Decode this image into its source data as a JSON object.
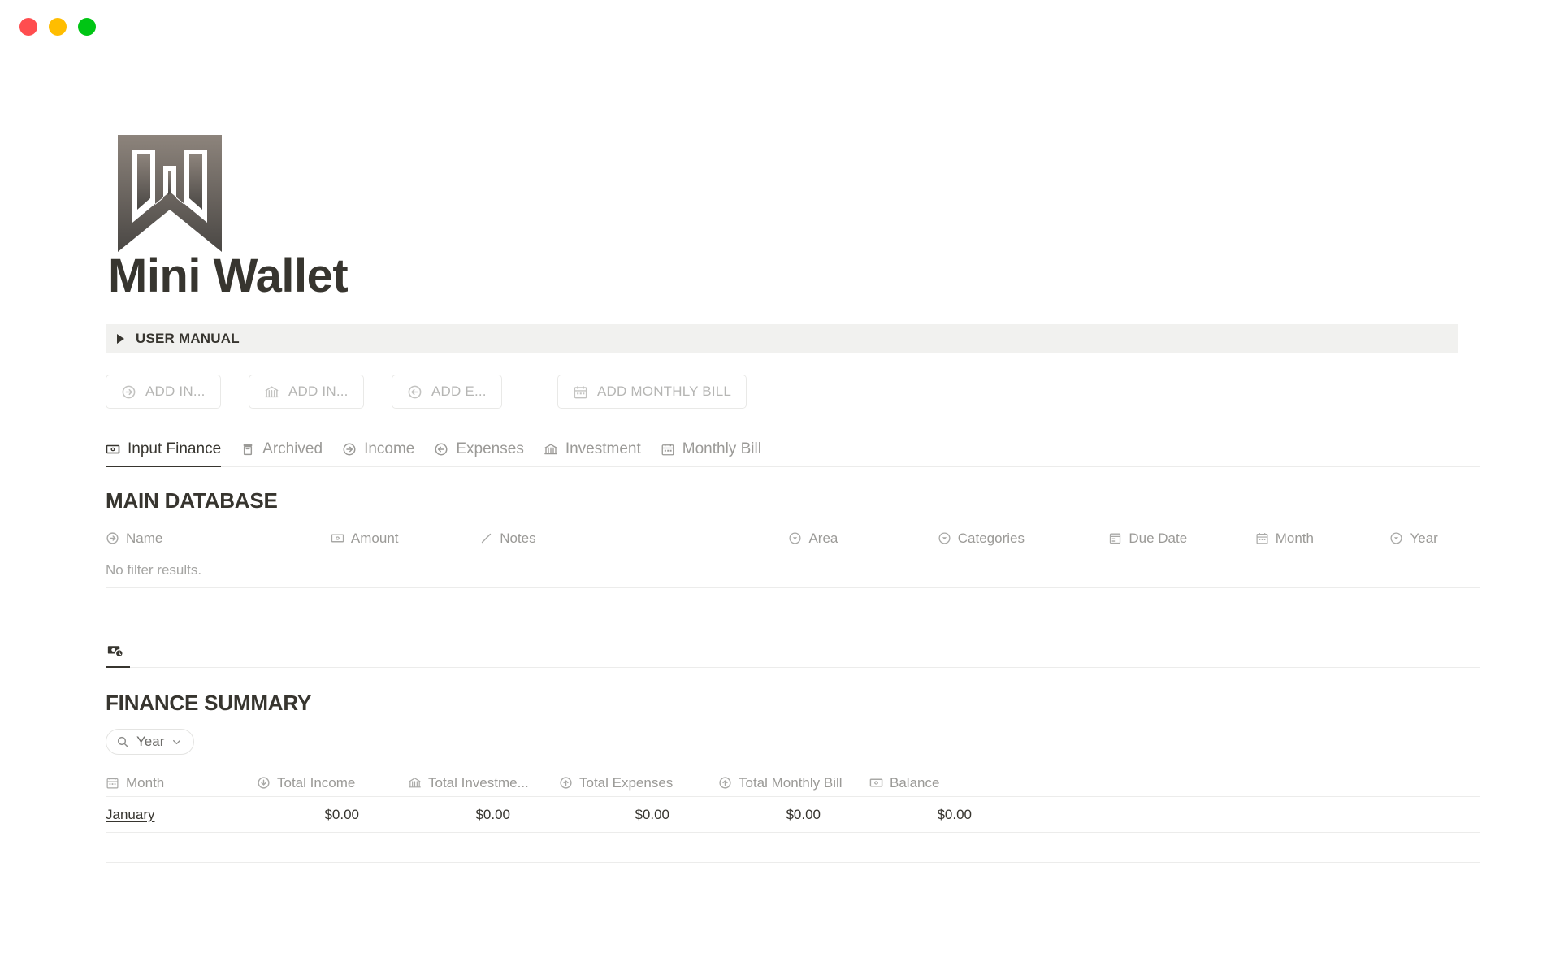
{
  "window": {
    "traffic_lights": [
      {
        "name": "close",
        "color": "#ff4d4f"
      },
      {
        "name": "minimize",
        "color": "#ffbd00"
      },
      {
        "name": "maximize",
        "color": "#00c514"
      }
    ]
  },
  "header": {
    "title": "Mini Wallet",
    "logo_alt": "mini-wallet-bookmark-logo"
  },
  "toggle": {
    "label": "USER MANUAL"
  },
  "action_buttons": [
    {
      "label": "ADD IN...",
      "icon": "arrow-right-circle-icon"
    },
    {
      "label": "ADD IN...",
      "icon": "bank-icon"
    },
    {
      "label": "ADD E...",
      "icon": "arrow-left-circle-icon"
    },
    {
      "label": "ADD MONTHLY BILL",
      "icon": "calendar-icon"
    }
  ],
  "tabs": [
    {
      "label": "Input Finance",
      "icon": "banknote-icon",
      "active": true
    },
    {
      "label": "Archived",
      "icon": "archive-icon",
      "active": false
    },
    {
      "label": "Income",
      "icon": "arrow-right-circle-icon",
      "active": false
    },
    {
      "label": "Expenses",
      "icon": "arrow-left-circle-icon",
      "active": false
    },
    {
      "label": "Investment",
      "icon": "bank-icon",
      "active": false
    },
    {
      "label": "Monthly Bill",
      "icon": "calendar-icon",
      "active": false
    }
  ],
  "main_database": {
    "heading": "MAIN DATABASE",
    "columns": [
      {
        "label": "Name",
        "icon": "arrow-right-circle-icon"
      },
      {
        "label": "Amount",
        "icon": "banknote-icon"
      },
      {
        "label": "Notes",
        "icon": "pencil-icon"
      },
      {
        "label": "Area",
        "icon": "chevron-down-circle-icon"
      },
      {
        "label": "Categories",
        "icon": "chevron-down-circle-icon"
      },
      {
        "label": "Due Date",
        "icon": "calendar-date-icon"
      },
      {
        "label": "Month",
        "icon": "calendar-icon"
      },
      {
        "label": "Year",
        "icon": "chevron-down-circle-icon"
      }
    ],
    "row_action_icon": "archive-icon",
    "empty_message": "No filter results."
  },
  "finance_section": {
    "tab_icon": "money-clock-icon",
    "heading": "FINANCE SUMMARY",
    "filter": {
      "label": "Year",
      "search_icon": "search-icon",
      "chevron_icon": "chevron-down-icon"
    },
    "columns": [
      {
        "label": "Month",
        "icon": "calendar-icon"
      },
      {
        "label": "Total Income",
        "icon": "arrow-down-circle-icon"
      },
      {
        "label": "Total Investme...",
        "icon": "bank-icon"
      },
      {
        "label": "Total Expenses",
        "icon": "arrow-up-circle-icon"
      },
      {
        "label": "Total Monthly Bill",
        "icon": "arrow-up-circle-icon"
      },
      {
        "label": "Balance",
        "icon": "banknote-icon"
      }
    ],
    "rows": [
      {
        "month": "January",
        "total_income": "$0.00",
        "total_investment": "$0.00",
        "total_expenses": "$0.00",
        "total_monthly_bill": "$0.00",
        "balance": "$0.00"
      }
    ]
  },
  "colors": {
    "text_primary": "#37352f",
    "text_muted": "#9b9a97",
    "text_faint": "#b6b6b4",
    "border": "#ececeb",
    "toggle_bg": "#f1f1ef",
    "logo_top": "#8a8179",
    "logo_bottom": "#4a4744"
  }
}
